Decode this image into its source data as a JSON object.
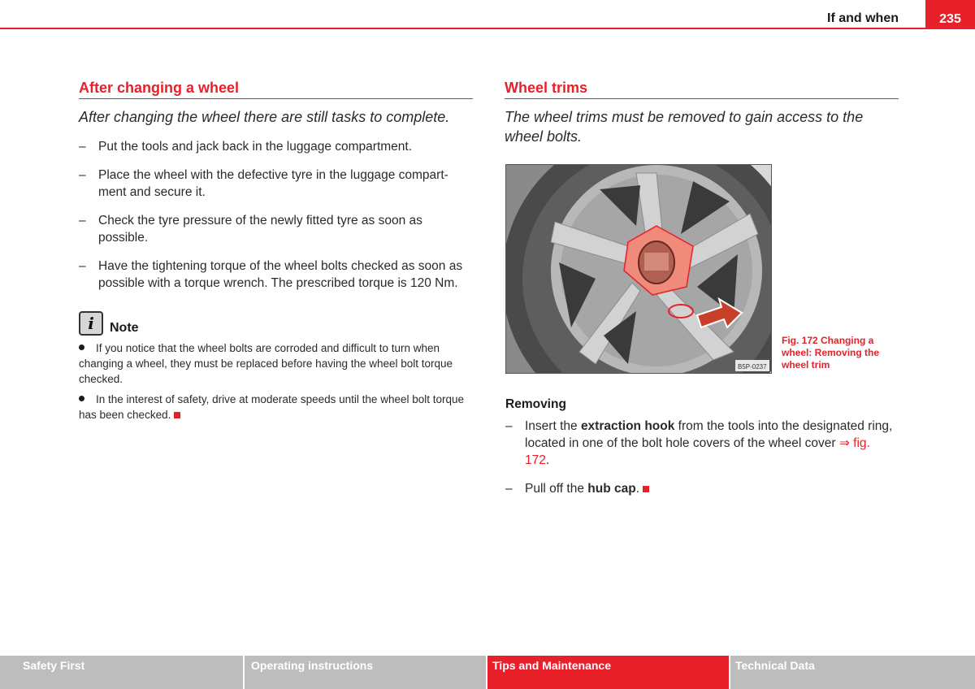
{
  "header": {
    "title": "If and when",
    "page_number": "235"
  },
  "left": {
    "heading": "After changing a wheel",
    "lead": "After changing the wheel there are still tasks to complete.",
    "items": [
      "Put the tools and jack back in the luggage compartment.",
      "Place the wheel with the defective tyre in the luggage compart-ment and secure it.",
      "Check the tyre pressure of the newly fitted tyre as soon as possible.",
      "Have the tightening torque of the wheel bolts checked as soon as possible with a torque wrench. The prescribed torque is 120 Nm."
    ],
    "note": {
      "icon": "info-icon",
      "title": "Note",
      "bullets": [
        "If you notice that the wheel bolts are corroded and difficult to turn when changing a wheel, they must be replaced before having the wheel bolt torque checked.",
        "In the interest of safety, drive at moderate speeds until the wheel bolt torque has been checked."
      ]
    }
  },
  "right": {
    "heading": "Wheel trims",
    "lead": "The wheel trims must be removed to gain access to the wheel bolts.",
    "figure": {
      "code": "B5P-0237",
      "caption": "Fig. 172   Changing a wheel: Removing the wheel trim"
    },
    "subheading": "Removing",
    "items": [
      {
        "pre": "Insert the ",
        "bold": "extraction hook",
        "post": " from the tools into the designated ring, located in one of the bolt hole covers of the wheel cover ",
        "xref": "⇒ fig. 172",
        "end": "."
      },
      {
        "pre": "Pull off the ",
        "bold": "hub cap",
        "post": ".",
        "xref": "",
        "end": ""
      }
    ]
  },
  "footer": {
    "tabs": [
      {
        "label": "Safety First",
        "active": false
      },
      {
        "label": "Operating instructions",
        "active": false
      },
      {
        "label": "Tips and Maintenance",
        "active": true
      },
      {
        "label": "Technical Data",
        "active": false
      }
    ]
  },
  "colors": {
    "accent": "#e8202a",
    "tab_inactive": "#bdbdbd"
  }
}
